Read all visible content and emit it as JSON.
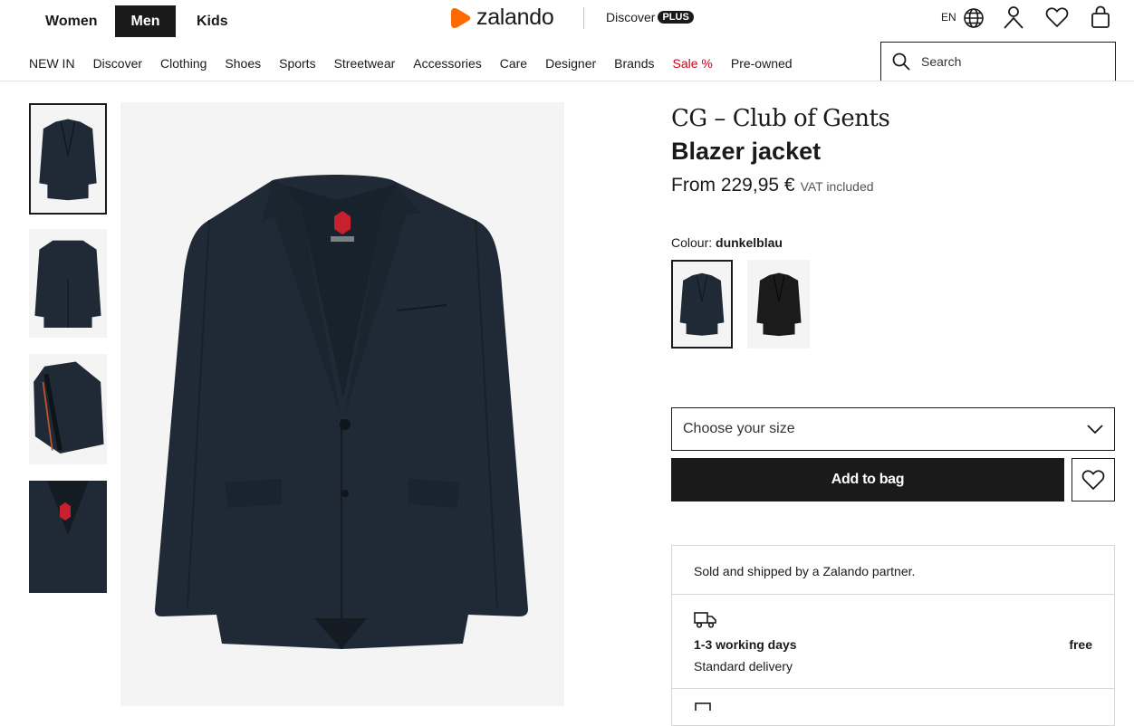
{
  "header": {
    "genders": [
      "Women",
      "Men",
      "Kids"
    ],
    "active_gender": "Men",
    "logo_text": "zalando",
    "discover_label": "Discover",
    "plus_label": "PLUS",
    "language": "EN",
    "icons": [
      "globe-icon",
      "user-icon",
      "heart-icon",
      "bag-icon"
    ]
  },
  "nav": {
    "items": [
      "NEW IN",
      "Discover",
      "Clothing",
      "Shoes",
      "Sports",
      "Streetwear",
      "Accessories",
      "Care",
      "Designer",
      "Brands",
      "Sale %",
      "Pre-owned"
    ],
    "sale_color": "#d0021b"
  },
  "search": {
    "placeholder": "Search"
  },
  "product": {
    "brand": "CG – Club of Gents",
    "name": "Blazer jacket",
    "price": "From 229,95 €",
    "vat": "VAT included",
    "colour_label": "Colour:",
    "colour_value": "dunkelblau",
    "size_placeholder": "Choose your size",
    "add_to_bag": "Add to bag"
  },
  "info": {
    "sold_by": "Sold and shipped by a Zalando partner.",
    "delivery_days": "1-3 working days",
    "delivery_price": "free",
    "delivery_type": "Standard delivery"
  },
  "colors": {
    "accent": "#ff6900",
    "text": "#1a1a1a",
    "jacket_navy": "#1f2a36",
    "jacket_black": "#1b1b1b"
  }
}
